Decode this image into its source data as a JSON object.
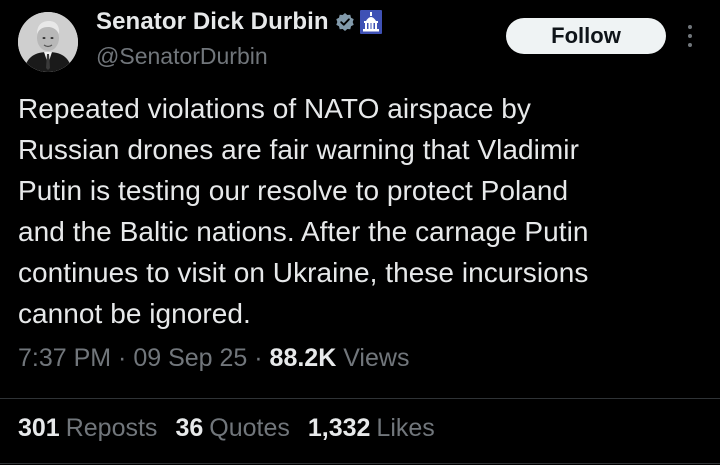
{
  "author": {
    "display_name": "Senator Dick Durbin",
    "handle": "@SenatorDurbin",
    "avatar_icon": "senator-portrait",
    "verified_icon": "verified-badge-icon",
    "affiliation_icon": "capitol-government-icon",
    "badge_color": "#829aab",
    "affiliation_color": "#5c6bc0"
  },
  "actions": {
    "follow_label": "Follow",
    "more_icon": "more-vertical-icon"
  },
  "tweet": {
    "lines": [
      "Repeated violations of NATO airspace by",
      "Russian drones are fair warning that Vladimir",
      "Putin is testing our resolve to protect Poland",
      "and the Baltic nations. After the carnage Putin",
      "continues to visit on Ukraine, these incursions",
      "cannot be ignored."
    ]
  },
  "meta": {
    "time": "7:37 PM",
    "sep1": " · ",
    "date": "09 Sep 25",
    "sep2": " · ",
    "views_count": "88.2K",
    "views_label": " Views"
  },
  "stats": {
    "reposts_count": "301",
    "reposts_label": "Reposts",
    "quotes_count": "36",
    "quotes_label": "Quotes",
    "likes_count": "1,332",
    "likes_label": "Likes"
  },
  "colors": {
    "background": "#000000",
    "primary_text": "#e7e9ea",
    "secondary_text": "#71767b",
    "divider": "#2f3336",
    "follow_bg": "#eff3f4"
  }
}
